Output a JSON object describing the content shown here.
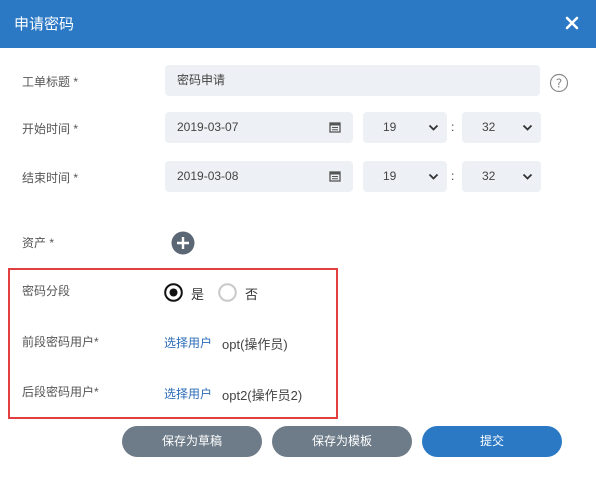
{
  "dialog": {
    "title": "申请密码"
  },
  "form": {
    "ticket_title": {
      "label": "工单标题 *",
      "value": "密码申请"
    },
    "start_time": {
      "label": "开始时间 *",
      "date": "2019-03-07",
      "hour": "19",
      "minute": "32"
    },
    "end_time": {
      "label": "结束时间 *",
      "date": "2019-03-08",
      "hour": "19",
      "minute": "32"
    },
    "assets": {
      "label": "资产 *"
    },
    "password_segment": {
      "label": "密码分段",
      "yes": "是",
      "no": "否",
      "selected": "是"
    },
    "front_user": {
      "label": "前段密码用户*",
      "select_link": "选择用户",
      "value": "opt(操作员)"
    },
    "back_user": {
      "label": "后段密码用户*",
      "select_link": "选择用户",
      "value": "opt2(操作员2)"
    }
  },
  "buttons": {
    "save_draft": "保存为草稿",
    "save_template": "保存为模板",
    "submit": "提交"
  },
  "colors": {
    "header": "#2b78c5",
    "submit": "#2b78c5",
    "secondary_button": "#6e7b88",
    "highlight_box": "#e24040",
    "link": "#2b6cb8"
  },
  "icons": [
    "close-icon",
    "help-icon",
    "calendar-icon",
    "chevron-down-icon",
    "add-icon"
  ]
}
